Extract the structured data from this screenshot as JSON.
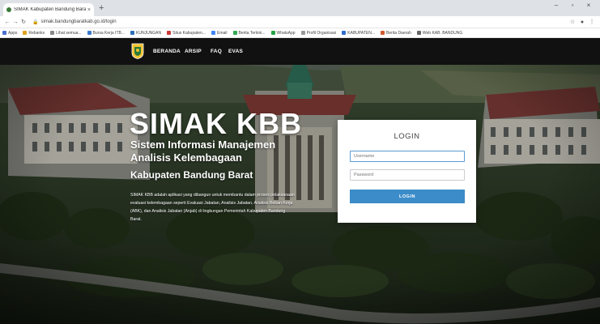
{
  "browser": {
    "tab_title": "SIMAK Kabupaten Bandung Barat",
    "tab_close": "×",
    "new_tab": "+",
    "window_controls": [
      "–",
      "▫",
      "×"
    ],
    "url": "simak.bandungbaratkab.go.id/login",
    "bookmarks": [
      {
        "label": "Apps",
        "color": "#4a6fd1"
      },
      {
        "label": "Rebanks",
        "color": "#e0a020"
      },
      {
        "label": "Lihat semua...",
        "color": "#888888"
      },
      {
        "label": "Bursa Kerja ITB...",
        "color": "#3a7acb"
      },
      {
        "label": "KUNJUNGAN",
        "color": "#2f6fb8"
      },
      {
        "label": "Situs Kabupaten...",
        "color": "#cc3b3b"
      },
      {
        "label": "Email",
        "color": "#4285f4"
      },
      {
        "label": "Berita Terkini...",
        "color": "#34a853"
      },
      {
        "label": "WhatsApp",
        "color": "#25a244"
      },
      {
        "label": "Profil Organisasi",
        "color": "#999999"
      },
      {
        "label": "KABUPATEN...",
        "color": "#2e6bd0"
      },
      {
        "label": "Berita Daerah",
        "color": "#d05a2e"
      },
      {
        "label": "Web KAB. BANDUNG",
        "color": "#666666"
      }
    ]
  },
  "site": {
    "nav_items": [
      "BERANDA",
      "ARSIP",
      "FAQ",
      "EVAS"
    ],
    "hero_title": "SIMAK KBB",
    "hero_subtitle": "Sistem Informasi Manajemen Analisis Kelembagaan",
    "hero_region": "Kabupaten Bandung Barat",
    "hero_description": "SIMAK KBB adalah aplikasi yang dibangun untuk membantu dalam proses pelaksanaan evaluasi kelembagaan seperti Evaluasi Jabatan, Analisis Jabatan, Analisis Beban Kerja (ABK), dan Analisis Jabatan (Anjab) di lingkungan Pemerintah Kabupaten Bandung Barat.",
    "login": {
      "title": "LOGIN",
      "username_placeholder": "Username",
      "password_placeholder": "Password",
      "button_label": "LOGIN"
    }
  },
  "colors": {
    "nav_bg": "#111111",
    "login_button": "#3b8cc9"
  }
}
